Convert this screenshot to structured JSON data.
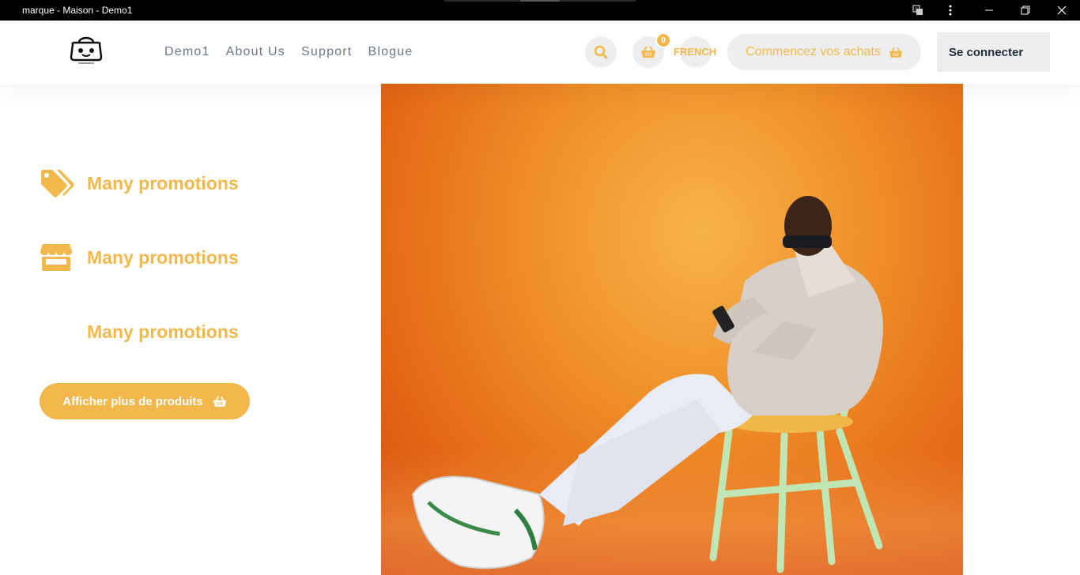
{
  "window": {
    "title": "marque - Maison - Demo1"
  },
  "header": {
    "logo_icon": "shopping-bag-logo",
    "nav": [
      "Demo1",
      "About Us",
      "Support",
      "Blogue"
    ],
    "cart_count": "0",
    "language": "FRENCH",
    "shop_button": "Commencez vos achats",
    "login_button": "Se connecter"
  },
  "features": [
    {
      "icon": "tags-icon",
      "label": "Many promotions"
    },
    {
      "icon": "store-icon",
      "label": "Many promotions"
    },
    {
      "icon": "",
      "label": "Many promotions"
    }
  ],
  "cta": {
    "label": "Afficher plus de produits"
  },
  "colors": {
    "accent": "#f2b84b",
    "nav_text": "#6b7785",
    "button_bg": "#eeeeee",
    "dark_text": "#1f2d3d"
  }
}
